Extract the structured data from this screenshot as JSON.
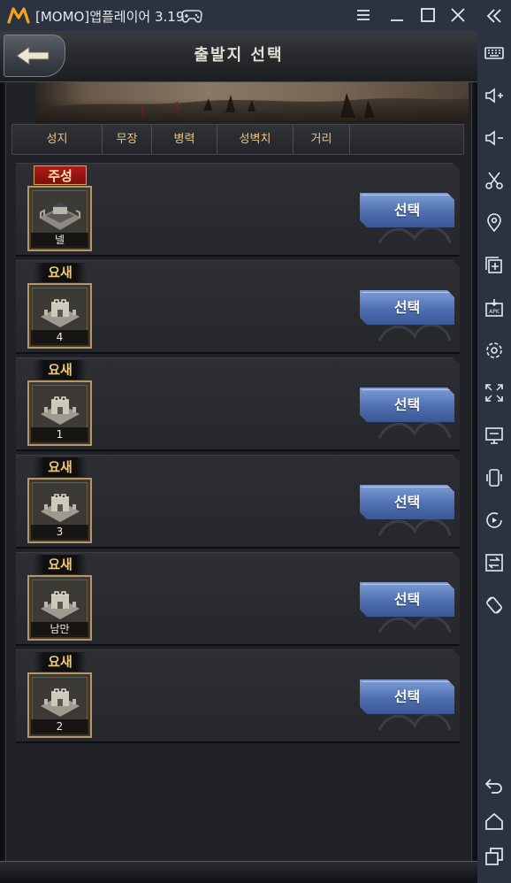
{
  "window": {
    "title": "[MOMO]앱플레이어 3.19",
    "accent_color": "#f2a51a"
  },
  "sidebar": {
    "icons": [
      "collapse-icon",
      "keyboard-icon",
      "volume-up-icon",
      "volume-down-icon",
      "scissors-icon",
      "location-pin-icon",
      "add-window-icon",
      "apk-install-icon",
      "settings-icon",
      "fullscreen-icon",
      "screen-icon",
      "shake-icon",
      "record-icon",
      "swap-icon",
      "rotate-icon",
      "back-icon",
      "home-icon",
      "recent-apps-icon"
    ]
  },
  "game": {
    "header": {
      "title": "출발지 선택"
    },
    "sort_tabs": [
      "성지",
      "무장",
      "병력",
      "성벽치",
      "거리"
    ],
    "rows": [
      {
        "badge": "주성",
        "badge_type": "main",
        "castle_name": "넬",
        "castle_type": "palace",
        "button": "선택"
      },
      {
        "badge": "요새",
        "badge_type": "fort",
        "castle_name": "4",
        "castle_type": "fortress",
        "button": "선택"
      },
      {
        "badge": "요새",
        "badge_type": "fort",
        "castle_name": "1",
        "castle_type": "fortress",
        "button": "선택"
      },
      {
        "badge": "요새",
        "badge_type": "fort",
        "castle_name": "3",
        "castle_type": "fortress",
        "button": "선택"
      },
      {
        "badge": "요새",
        "badge_type": "fort",
        "castle_name": "남만",
        "castle_type": "fortress",
        "button": "선택"
      },
      {
        "badge": "요새",
        "badge_type": "fort",
        "castle_name": "2",
        "castle_type": "fortress",
        "button": "선택"
      }
    ],
    "colors": {
      "select_button": "#5a7cc0",
      "tab_text": "#e8c48a",
      "main_badge": "#a3171a",
      "fort_badge_text": "#f1c878"
    }
  }
}
